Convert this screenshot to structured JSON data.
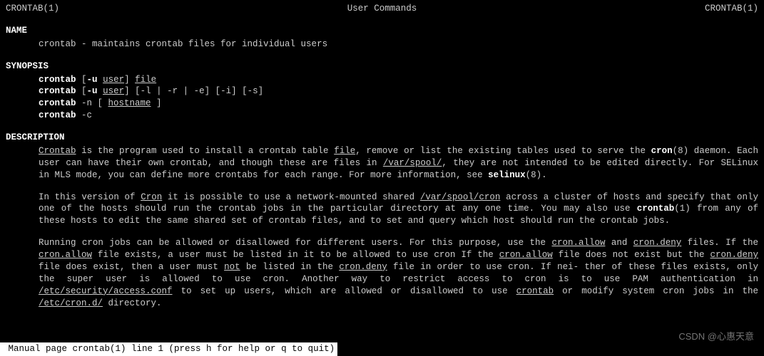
{
  "header": {
    "left": "CRONTAB(1)",
    "center": "User Commands",
    "right": "CRONTAB(1)"
  },
  "sections": {
    "name": {
      "heading": "NAME",
      "text": "crontab - maintains crontab files for individual users"
    },
    "synopsis": {
      "heading": "SYNOPSIS",
      "lines": {
        "l1_cmd": "crontab",
        "l1_opt": "-u",
        "l1_user": "user",
        "l1_file": "file",
        "l2_cmd": "crontab",
        "l2_opt": "-u",
        "l2_user": "user",
        "l2_rest": "] [-l | -r | -e] [-i] [-s]",
        "l3_cmd": "crontab",
        "l3_pre": " -n [ ",
        "l3_host": "hostname",
        "l3_post": " ]",
        "l4": "crontab",
        "l4_rest": " -c"
      }
    },
    "description": {
      "heading": "DESCRIPTION",
      "p1": {
        "crontab": "Crontab",
        "a": "  is  the  program used to install a crontab table ",
        "file": "file",
        "b": ", remove or list the existing tables used to serve the ",
        "cron": "cron",
        "c": "(8) daemon.  Each user can have their own crontab, and though these are files in ",
        "spool": "/var/spool/",
        "d": ", they are not intended to be edited directly.  For SELinux in MLS mode, you can define more crontabs for each range.  For more information, see ",
        "selinux": "selinux",
        "e": "(8)."
      },
      "p2": {
        "a": "In this version of ",
        "cron": "Cron",
        "b": " it is possible to use a network-mounted shared ",
        "spoolcron": "/var/spool/cron",
        "c": " across a cluster of hosts and specify that only one of the hosts should run the crontab jobs in the particular directory at  any  one  time.   You  may  also  use ",
        "crontab": "crontab",
        "d": "(1)  from any of these hosts to edit the same shared set of crontab files, and to set and query which host should run the crontab jobs."
      },
      "p3": {
        "a": "Running cron jobs can be allowed or disallowed for different users.  For this purpose,  use  the  ",
        "allow1": "cron.allow",
        "b": "  and  ",
        "deny1": "cron.deny",
        "c": " files.  If the ",
        "allow2": "cron.allow",
        "d": " file exists, a user must be listed in it to be allowed to use cron If the ",
        "allow3": "cron.allow",
        "e": " file does not exist but the ",
        "deny2": "cron.deny",
        "f": " file does exist, then a user must ",
        "not": "not",
        "g": " be listed in the ",
        "deny3": "cron.deny",
        "h": " file in order to use cron.  If nei‐ ther  of  these  files exists, only the super user is allowed to use cron.  Another way to restrict access to cron is to use PAM authentication in ",
        "access": "/etc/security/access.conf",
        "i": " to set up users, which are allowed or disallowed to use  ",
        "crontab": "crontab",
        "j": "  or  modify system cron jobs in the ",
        "crond": "/etc/cron.d/",
        "k": " directory."
      }
    }
  },
  "statusbar": " Manual page crontab(1) line 1 (press h for help or q to quit)",
  "watermark": "CSDN @心惠天意"
}
